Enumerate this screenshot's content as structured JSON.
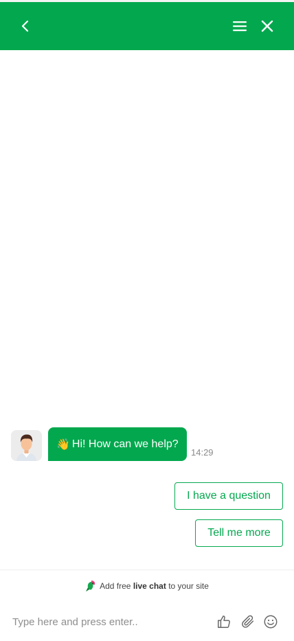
{
  "header": {
    "back_icon": "chevron-left-icon",
    "menu_icon": "hamburger-menu-icon",
    "close_icon": "close-icon",
    "background": "#03a84e"
  },
  "chat": {
    "agent_avatar": "agent-avatar",
    "message_emoji": "👋",
    "message_text": "Hi! How can we help?",
    "message_time": "14:29",
    "quick_replies": [
      "I have a question",
      "Tell me more"
    ]
  },
  "promo": {
    "prefix": "Add free",
    "bold": "live chat",
    "suffix": "to your site"
  },
  "composer": {
    "placeholder": "Type here and press enter..",
    "like_icon": "thumbs-up-icon",
    "attach_icon": "paperclip-icon",
    "emoji_icon": "smiley-icon"
  },
  "colors": {
    "accent": "#03a84e",
    "muted_text": "#8a8a8a"
  }
}
